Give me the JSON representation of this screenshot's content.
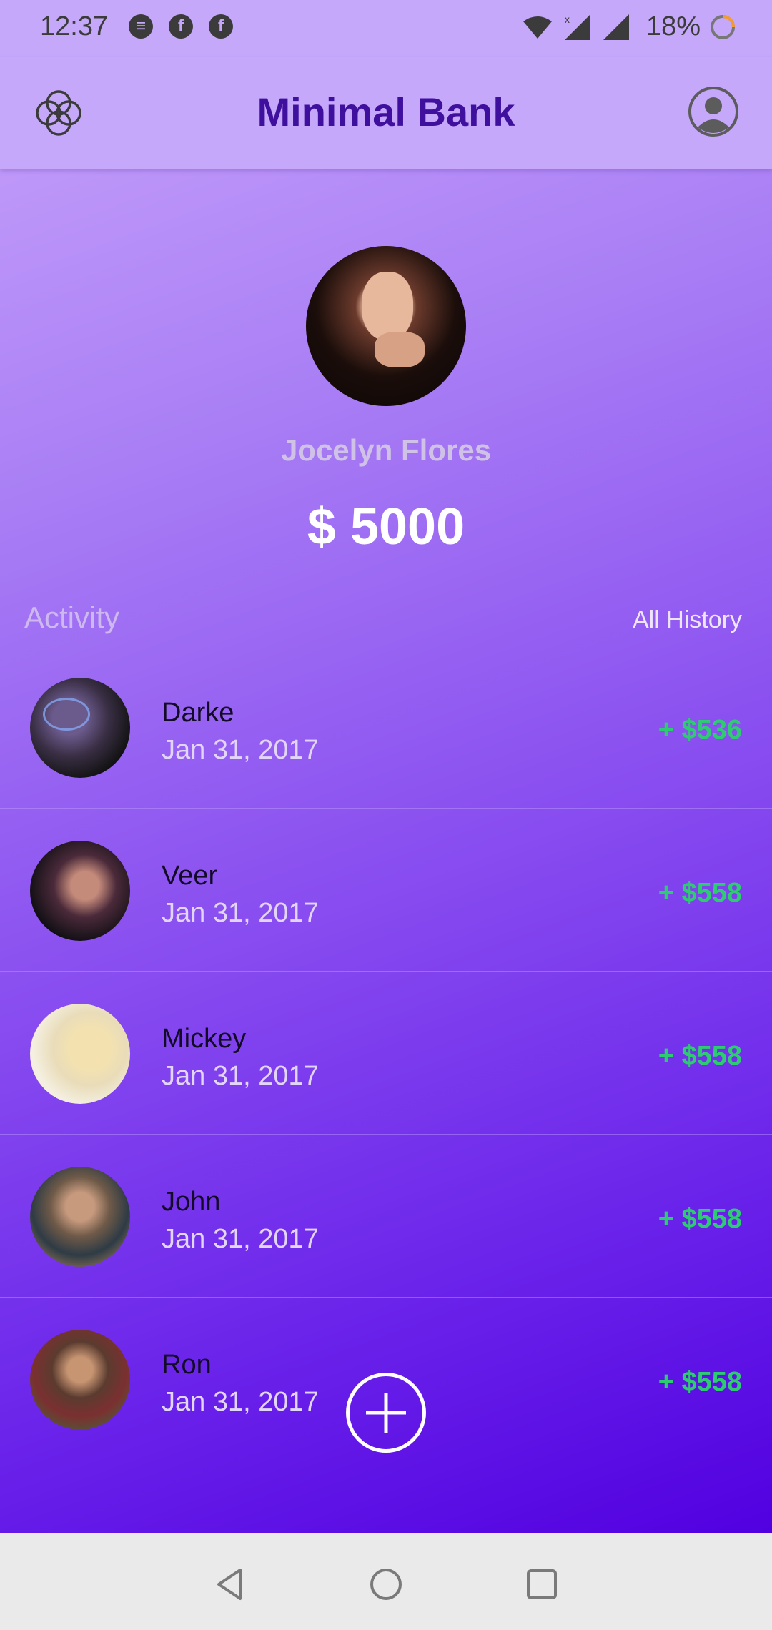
{
  "status_bar": {
    "time": "12:37",
    "notification_icons": [
      "message-icon",
      "facebook-icon",
      "facebook-icon"
    ],
    "battery": "18%"
  },
  "app_bar": {
    "title": "Minimal Bank",
    "logo_icon": "flower-logo-icon",
    "profile_icon": "account-circle-icon"
  },
  "profile": {
    "name": "Jocelyn Flores",
    "balance": "$ 5000"
  },
  "activity": {
    "title": "Activity",
    "all_history_label": "All History",
    "items": [
      {
        "name": "Darke",
        "date": "Jan 31, 2017",
        "amount": "+ $536"
      },
      {
        "name": "Veer",
        "date": "Jan 31, 2017",
        "amount": "+ $558"
      },
      {
        "name": "Mickey",
        "date": "Jan 31, 2017",
        "amount": "+ $558"
      },
      {
        "name": "John",
        "date": "Jan 31, 2017",
        "amount": "+ $558"
      },
      {
        "name": "Ron",
        "date": "Jan 31, 2017",
        "amount": "+ $558"
      }
    ]
  },
  "fab": {
    "icon": "plus-icon"
  },
  "colors": {
    "accent": "#3f0f9e",
    "app_bar": "#c6a8fb",
    "amount_positive": "#2ecc71",
    "gradient_end": "#5100e0"
  }
}
